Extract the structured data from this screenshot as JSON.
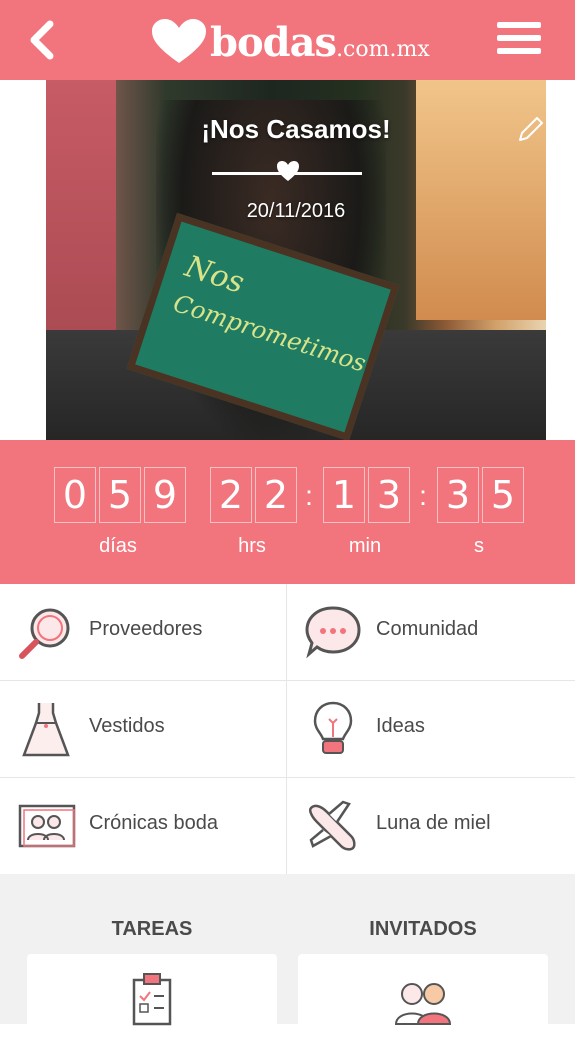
{
  "header": {
    "back_icon": "chevron-left-icon",
    "logo_word": "bodas",
    "logo_domain": ".com.mx",
    "menu_icon": "hamburger-menu-icon",
    "brand_color": "#f2747c"
  },
  "cover": {
    "title": "¡Nos Casamos!",
    "date": "20/11/2016",
    "board_text_line1": "Nos",
    "board_text_line2": "Comprometimos",
    "edit_icon": "pencil-icon"
  },
  "countdown": {
    "days": [
      "0",
      "5",
      "9"
    ],
    "hours": [
      "2",
      "2"
    ],
    "minutes": [
      "1",
      "3"
    ],
    "seconds": [
      "3",
      "5"
    ],
    "labels": {
      "days": "días",
      "hours": "hrs",
      "minutes": "min",
      "seconds": "s"
    }
  },
  "menu": {
    "items": [
      {
        "label": "Proveedores",
        "icon": "magnifier-icon"
      },
      {
        "label": "Comunidad",
        "icon": "chat-bubble-icon"
      },
      {
        "label": "Vestidos",
        "icon": "dress-icon"
      },
      {
        "label": "Ideas",
        "icon": "lightbulb-icon"
      },
      {
        "label": "Crónicas boda",
        "icon": "photo-couple-icon"
      },
      {
        "label": "Luna de miel",
        "icon": "airplane-icon"
      }
    ]
  },
  "bottom": {
    "tasks_label": "TAREAS",
    "guests_label": "INVITADOS",
    "tasks_icon": "clipboard-icon",
    "guests_icon": "guests-icon"
  }
}
